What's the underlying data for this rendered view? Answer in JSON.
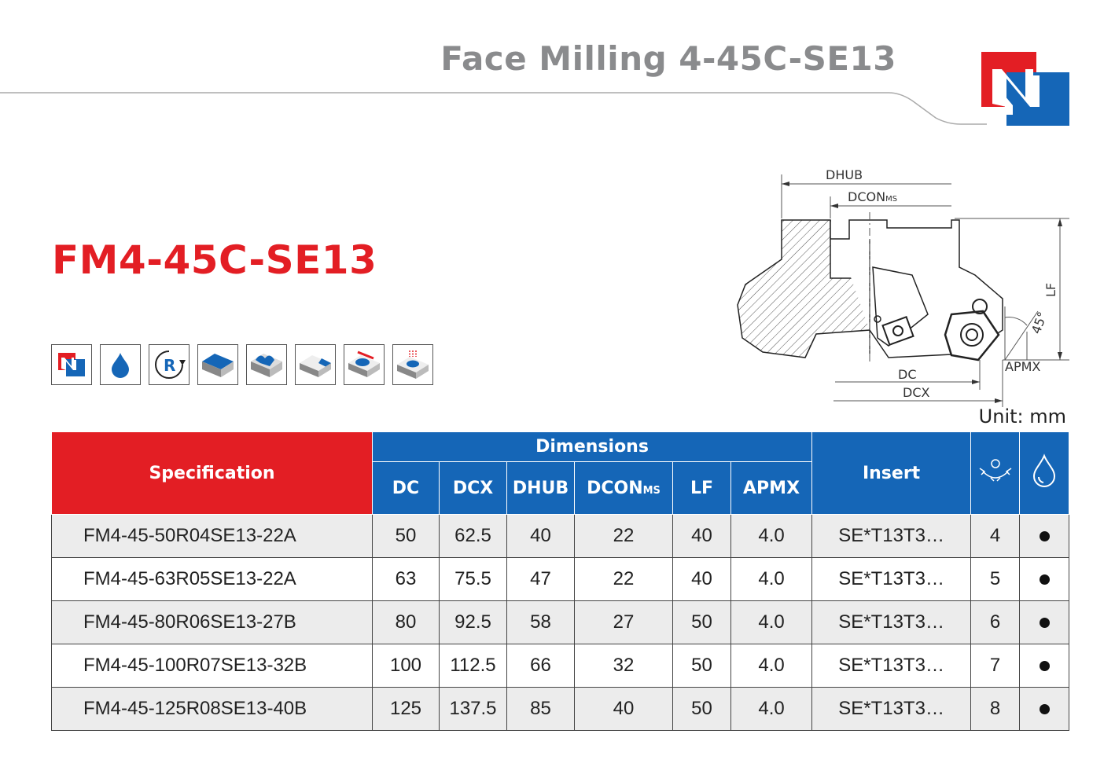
{
  "header": {
    "title": "Face Milling 4-45C-SE13"
  },
  "product": {
    "title": "FM4-45C-SE13"
  },
  "icons": [
    "brand-n-icon",
    "coolant-drop-icon",
    "right-hand-rotation-icon",
    "face-milling-icon",
    "profile-milling-icon",
    "chamfer-milling-icon",
    "slot-milling-icon",
    "plunge-milling-icon"
  ],
  "drawing": {
    "labels": {
      "dhub": "DHUB",
      "dcon": "DCON",
      "dcon_sub": "MS",
      "lf": "LF",
      "angle": "45°",
      "apmx": "APMX",
      "dc": "DC",
      "dcx": "DCX"
    }
  },
  "unit": "Unit: mm",
  "table": {
    "spec_header": "Specification",
    "dimensions_header": "Dimensions",
    "insert_header": "Insert",
    "columns": {
      "dc": "DC",
      "dcx": "DCX",
      "dhub": "DHUB",
      "dcon": "DCON",
      "dcon_sub": "MS",
      "lf": "LF",
      "apmx": "APMX"
    },
    "teeth_icon": "teeth-count-icon",
    "coolant_icon": "coolant-drop-icon",
    "rows": [
      {
        "spec": "FM4-45-50R04SE13-22A",
        "dc": "50",
        "dcx": "62.5",
        "dhub": "40",
        "dcon": "22",
        "lf": "40",
        "apmx": "4.0",
        "insert": "SE*T13T3…",
        "teeth": "4"
      },
      {
        "spec": "FM4-45-63R05SE13-22A",
        "dc": "63",
        "dcx": "75.5",
        "dhub": "47",
        "dcon": "22",
        "lf": "40",
        "apmx": "4.0",
        "insert": "SE*T13T3…",
        "teeth": "5"
      },
      {
        "spec": "FM4-45-80R06SE13-27B",
        "dc": "80",
        "dcx": "92.5",
        "dhub": "58",
        "dcon": "27",
        "lf": "50",
        "apmx": "4.0",
        "insert": "SE*T13T3…",
        "teeth": "6"
      },
      {
        "spec": "FM4-45-100R07SE13-32B",
        "dc": "100",
        "dcx": "112.5",
        "dhub": "66",
        "dcon": "32",
        "lf": "50",
        "apmx": "4.0",
        "insert": "SE*T13T3…",
        "teeth": "7"
      },
      {
        "spec": "FM4-45-125R08SE13-40B",
        "dc": "125",
        "dcx": "137.5",
        "dhub": "85",
        "dcon": "40",
        "lf": "50",
        "apmx": "4.0",
        "insert": "SE*T13T3…",
        "teeth": "8"
      }
    ]
  },
  "colors": {
    "brand_red": "#e31e24",
    "brand_blue": "#1566b7",
    "title_gray": "#8a8b8d",
    "row_shade": "#ececec"
  }
}
